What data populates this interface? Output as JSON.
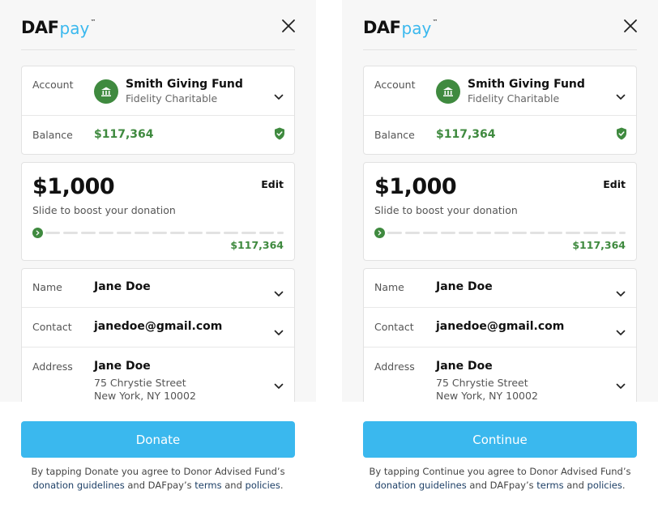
{
  "screens": [
    {
      "brand": {
        "daf": "DAF",
        "pay": "pay",
        "tm": "™"
      },
      "account": {
        "label": "Account",
        "fund_name": "Smith Giving Fund",
        "fund_provider": "Fidelity Charitable",
        "balance_label": "Balance",
        "balance": "$117,364"
      },
      "donation": {
        "amount": "$1,000",
        "edit_label": "Edit",
        "hint": "Slide to boost your donation",
        "max": "$117,364",
        "slider_fraction": 0.0
      },
      "donor": {
        "name_label": "Name",
        "name": "Jane Doe",
        "contact_label": "Contact",
        "email": "janedoe@gmail.com",
        "address_label": "Address",
        "address_name": "Jane Doe",
        "street": "75 Chrystie Street",
        "city": "New York, NY 10002"
      },
      "cta_label": "Donate",
      "legal": {
        "prefix": "By tapping Donate you agree to Donor Advised Fund’s",
        "link_guidelines": "donation guidelines",
        "mid1": " and DAFpay’s ",
        "link_terms": "terms",
        "mid2": " and ",
        "link_policies": "policies",
        "suffix": "."
      }
    },
    {
      "brand": {
        "daf": "DAF",
        "pay": "pay",
        "tm": "™"
      },
      "account": {
        "label": "Account",
        "fund_name": "Smith Giving Fund",
        "fund_provider": "Fidelity Charitable",
        "balance_label": "Balance",
        "balance": "$117,364"
      },
      "donation": {
        "amount": "$1,000",
        "edit_label": "Edit",
        "hint": "Slide to boost your donation",
        "max": "$117,364",
        "slider_fraction": 0.0
      },
      "donor": {
        "name_label": "Name",
        "name": "Jane Doe",
        "contact_label": "Contact",
        "email": "janedoe@gmail.com",
        "address_label": "Address",
        "address_name": "Jane Doe",
        "street": "75 Chrystie Street",
        "city": "New York, NY 10002"
      },
      "cta_label": "Continue",
      "legal": {
        "prefix": "By tapping Continue you agree to Donor Advised Fund’s",
        "link_guidelines": "donation guidelines",
        "mid1": " and DAFpay’s ",
        "link_terms": "terms",
        "mid2": " and ",
        "link_policies": "policies",
        "suffix": "."
      }
    }
  ],
  "colors": {
    "brand_blue": "#3ab8ee",
    "brand_green": "#3f8a3f",
    "link": "#1d3f66"
  },
  "icons": {
    "close": "close-icon",
    "bank": "bank-icon",
    "shield": "shield-check-icon",
    "chevron": "chevron-down-icon",
    "slider_arrow": "chevron-right-icon"
  }
}
